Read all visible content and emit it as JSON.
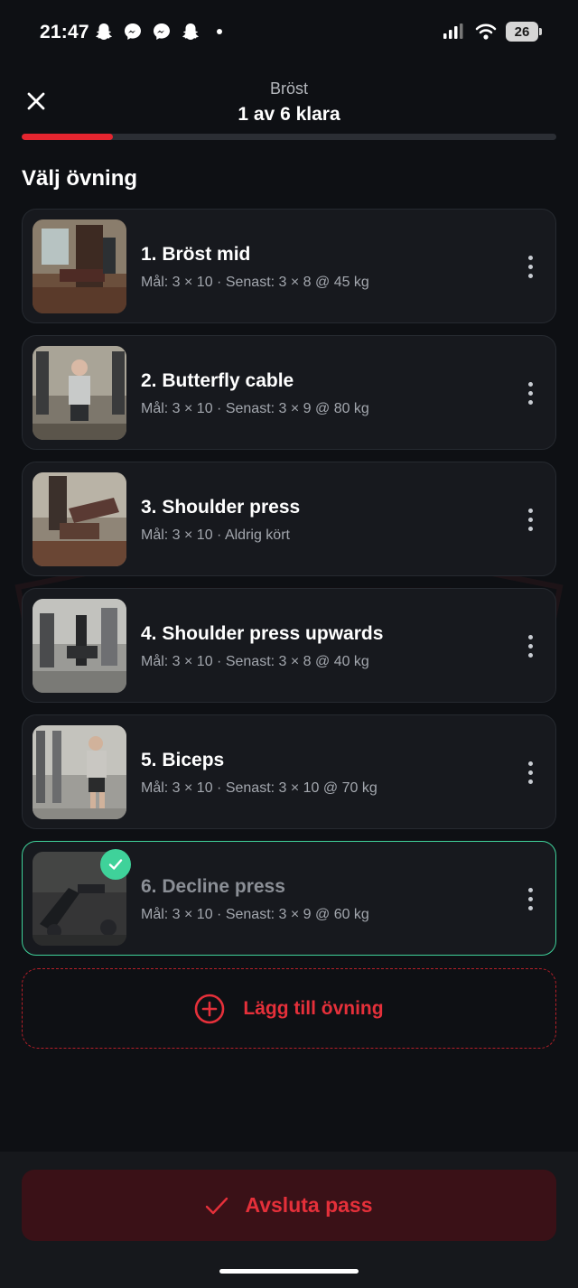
{
  "status_bar": {
    "time": "21:47",
    "left_icons": [
      "snapchat-icon",
      "messenger-icon",
      "messenger-icon",
      "snapchat-icon",
      "dot-icon"
    ],
    "battery": "26"
  },
  "header": {
    "subtitle": "Bröst",
    "title": "1 av 6 klara",
    "progress": 0.17,
    "progress_color": "#e5252f"
  },
  "section_title": "Välj övning",
  "exercises": [
    {
      "name": "1. Bröst mid",
      "meta": "Mål: 3 × 10 · Senast: 3 × 8 @ 45 kg",
      "done": false
    },
    {
      "name": "2. Butterfly cable",
      "meta": "Mål: 3 × 10 · Senast: 3 × 9 @ 80 kg",
      "done": false
    },
    {
      "name": "3. Shoulder press",
      "meta": "Mål: 3 × 10 · Aldrig kört",
      "done": false
    },
    {
      "name": "4. Shoulder press upwards",
      "meta": "Mål: 3 × 10 · Senast: 3 × 8 @ 40 kg",
      "done": false
    },
    {
      "name": "5. Biceps",
      "meta": "Mål: 3 × 10 · Senast: 3 × 10 @ 70 kg",
      "done": false
    },
    {
      "name": "6. Decline press",
      "meta": "Mål: 3 × 10 · Senast: 3 × 9 @ 60 kg",
      "done": true
    }
  ],
  "add_exercise": {
    "label": "Lägg till övning",
    "icon": "plus-circle-icon"
  },
  "finish": {
    "label": "Avsluta pass",
    "icon": "checkmark-icon"
  },
  "colors": {
    "accent": "#e5303a",
    "done": "#3fd29a",
    "background": "#0e1014",
    "card": "#17191e"
  }
}
